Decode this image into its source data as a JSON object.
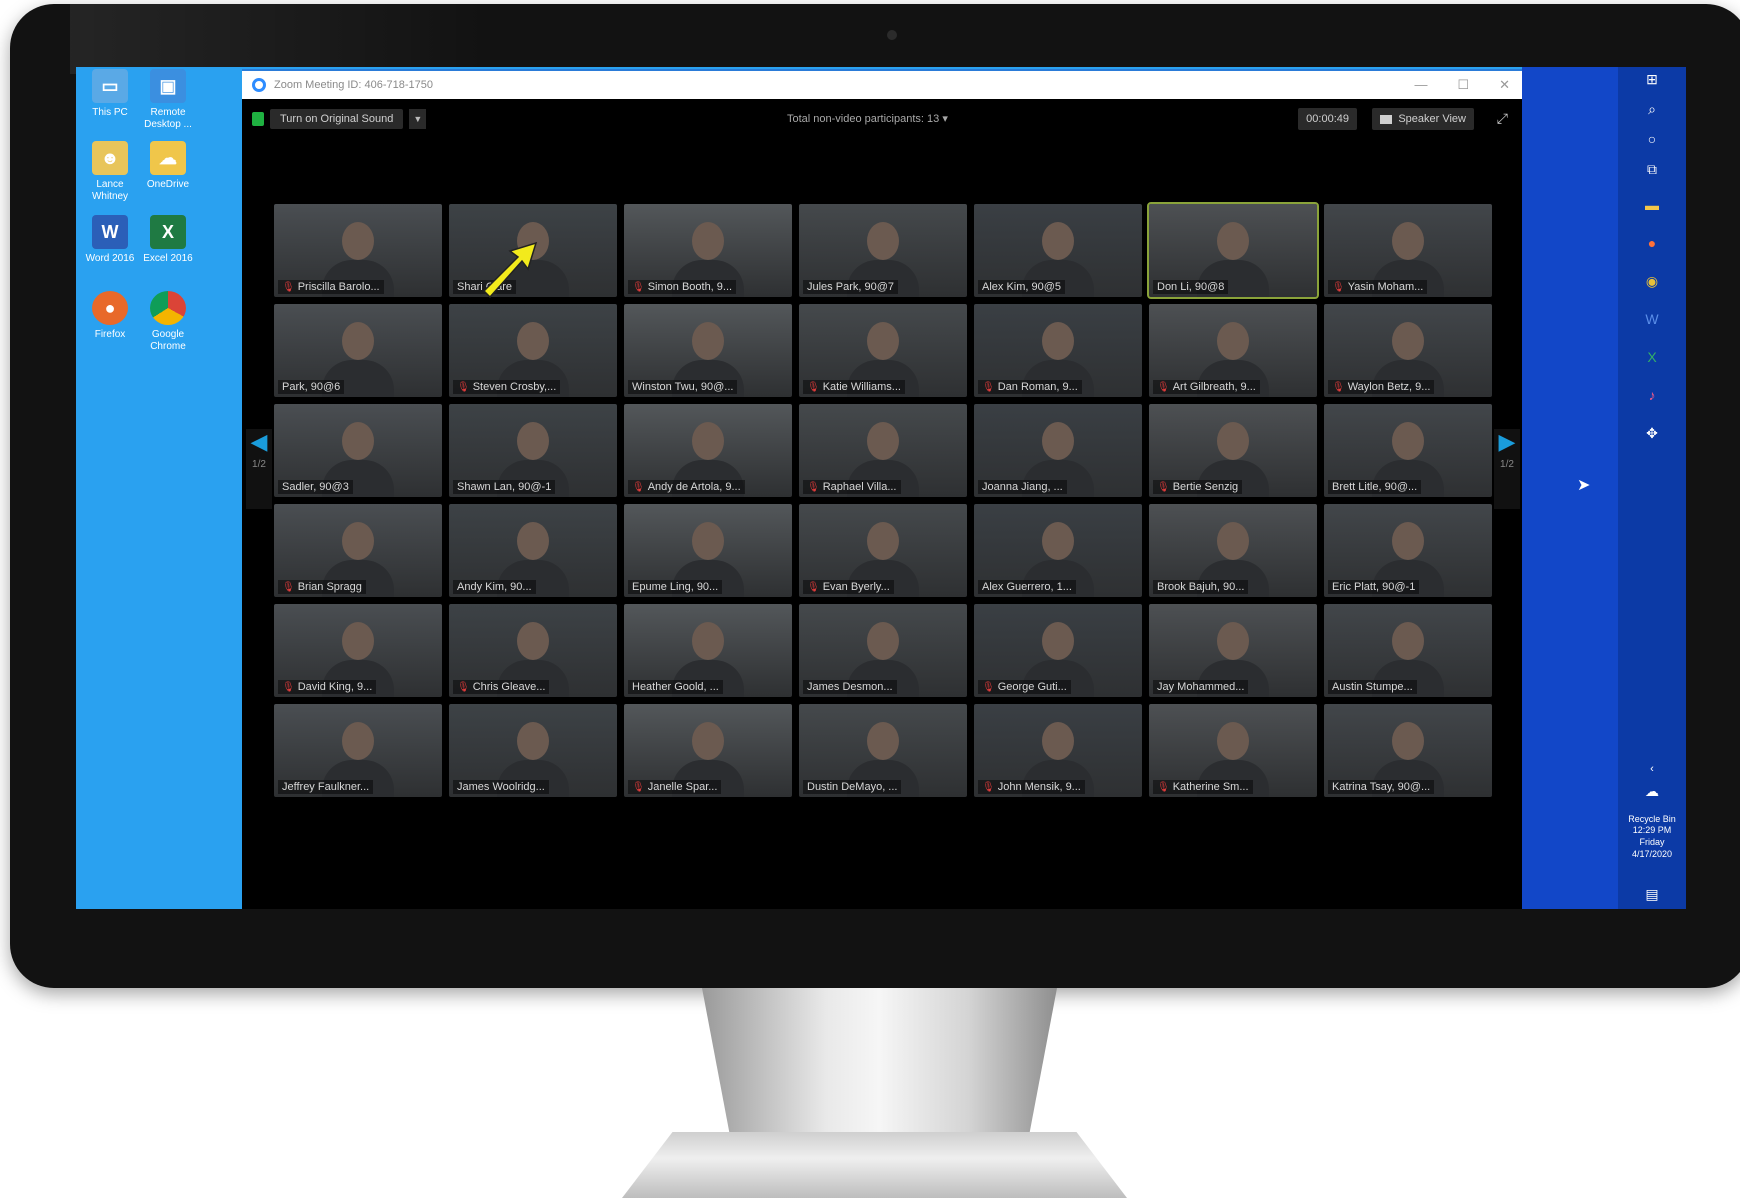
{
  "zoom": {
    "title": "Zoom Meeting ID: 406-718-1750",
    "original_sound_label": "Turn on Original Sound",
    "non_video_label": "Total non-video participants: 13",
    "timer": "00:00:49",
    "speaker_view_label": "Speaker View",
    "page_left": "1/2",
    "page_right": "1/2"
  },
  "desktop_icons": [
    {
      "label": "This PC",
      "icon": "this-pc-icon"
    },
    {
      "label": "Remote Desktop ...",
      "icon": "remote-desktop-icon"
    },
    {
      "label": "Lance Whitney",
      "icon": "user-folder-icon"
    },
    {
      "label": "OneDrive",
      "icon": "onedrive-icon"
    },
    {
      "label": "Word 2016",
      "icon": "word-icon"
    },
    {
      "label": "Excel 2016",
      "icon": "excel-icon"
    },
    {
      "label": "Firefox",
      "icon": "firefox-icon"
    },
    {
      "label": "Google Chrome",
      "icon": "chrome-icon"
    }
  ],
  "participants": [
    "Priscilla Barolo...",
    "Shari Clare",
    "Simon Booth, 9...",
    "Jules Park, 90@7",
    "Alex Kim, 90@5",
    "Don Li, 90@8",
    "Yasin Moham...",
    "Park, 90@6",
    "Steven Crosby,...",
    "Winston Twu, 90@...",
    "Katie Williams...",
    "Dan Roman, 9...",
    "Art Gilbreath, 9...",
    "Waylon Betz, 9...",
    "Sadler, 90@3",
    "Shawn Lan, 90@-1",
    "Andy de Artola, 9...",
    "Raphael Villa...",
    "Joanna Jiang, ...",
    "Bertie Senzig",
    "Brett Litle, 90@...",
    "Brian Spragg",
    "Andy Kim, 90...",
    "Epume Ling, 90...",
    "Evan Byerly...",
    "Alex Guerrero, 1...",
    "Brook Bajuh, 90...",
    "Eric Platt, 90@-1",
    "David King, 9...",
    "Chris Gleave...",
    "Heather Goold, ...",
    "James Desmon...",
    "George Guti...",
    "Jay Mohammed...",
    "Austin Stumpe...",
    "Jeffrey Faulkner...",
    "James Woolridg...",
    "Janelle Spar...",
    "Dustin DeMayo, ...",
    "John Mensik, 9...",
    "Katherine Sm...",
    "Katrina Tsay, 90@..."
  ],
  "muted_indexes": [
    0,
    2,
    6,
    8,
    10,
    11,
    12,
    13,
    16,
    17,
    19,
    21,
    24,
    28,
    29,
    32,
    37,
    39,
    40
  ],
  "active_index": 5,
  "taskbar": {
    "clock_time": "12:29 PM",
    "clock_day": "Friday",
    "clock_date": "4/17/2020",
    "recycle_label": "Recycle Bin"
  },
  "colors": {
    "desktop_bg": "#2aa1f0",
    "taskbar": "#1247c8",
    "active_speaker": "#8aa33a",
    "arrow": "#f2ea1c"
  }
}
